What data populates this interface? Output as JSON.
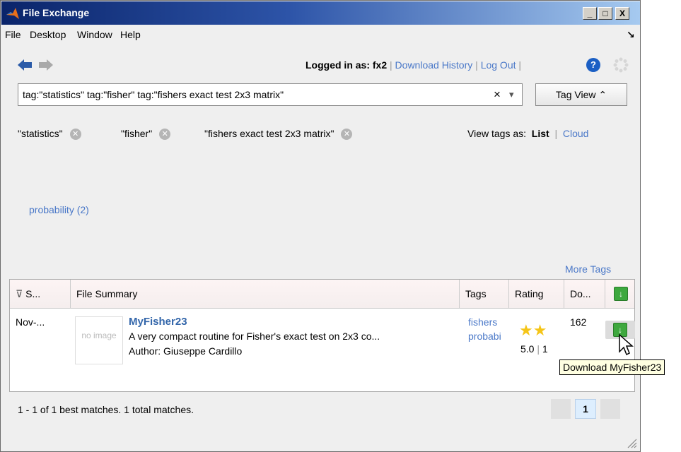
{
  "window": {
    "title": "File Exchange",
    "buttons": {
      "minimize": "_",
      "maximize": "□",
      "close": "X"
    }
  },
  "menu": {
    "items": [
      "File",
      "Desktop",
      "Window",
      "Help"
    ],
    "overflow": "↘"
  },
  "toolbar": {
    "logged_in_label": "Logged in as: fx2",
    "separator": "|",
    "download_history": "Download History",
    "log_out": "Log Out",
    "help_icon": "?"
  },
  "search": {
    "value": "tag:\"statistics\" tag:\"fisher\" tag:\"fishers exact test 2x3 matrix\"",
    "clear": "×",
    "dropdown": "▾"
  },
  "tag_view_button": "Tag View ⌃",
  "active_tags": [
    {
      "label": "\"statistics\"",
      "remove": "✕"
    },
    {
      "label": "\"fisher\"",
      "remove": "✕"
    },
    {
      "label": "\"fishers exact test 2x3 matrix\"",
      "remove": "✕"
    }
  ],
  "view_tags": {
    "label": "View tags as:",
    "list": "List",
    "sep": "|",
    "cloud": "Cloud"
  },
  "tag_cloud": {
    "items": [
      "probability (2)"
    ],
    "more_tags": "More Tags"
  },
  "table": {
    "headers": {
      "sort": "S...",
      "summary": "File Summary",
      "tags": "Tags",
      "rating": "Rating",
      "downloads": "Do..."
    },
    "rows": [
      {
        "date": "Nov-...",
        "no_image": "no image",
        "title": "MyFisher23",
        "description": "A very compact routine for Fisher's exact test on 2x3 co...",
        "author": "Author: Giuseppe Cardillo",
        "tags": [
          "fishers",
          "probabi"
        ],
        "rating": 5.0,
        "rating_text": "5.0",
        "rating_count": "1",
        "downloads": "162"
      }
    ]
  },
  "tooltip": "Download MyFisher23",
  "status": "1 - 1 of 1 best matches. 1 total matches.",
  "pager": {
    "current": "1"
  },
  "colors": {
    "title_start": "#0a246a",
    "link": "#4a78c8",
    "star": "#f5c518",
    "download_green": "#3ea83e"
  }
}
